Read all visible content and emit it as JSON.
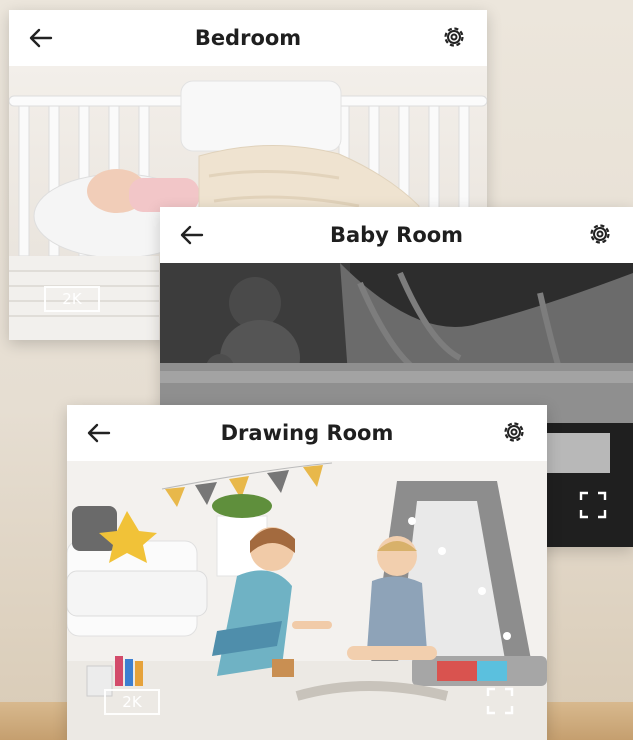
{
  "cards": {
    "bedroom": {
      "title": "Bedroom",
      "resolution": "2K"
    },
    "baby_room": {
      "title": "Baby Room"
    },
    "drawing_room": {
      "title": "Drawing Room",
      "resolution": "2K"
    }
  },
  "icons": {
    "back": "arrow-left-icon",
    "settings": "gear-icon",
    "fullscreen": "fullscreen-icon"
  },
  "colors": {
    "title_text": "#1f1f1f",
    "header_bg": "#ffffff"
  }
}
